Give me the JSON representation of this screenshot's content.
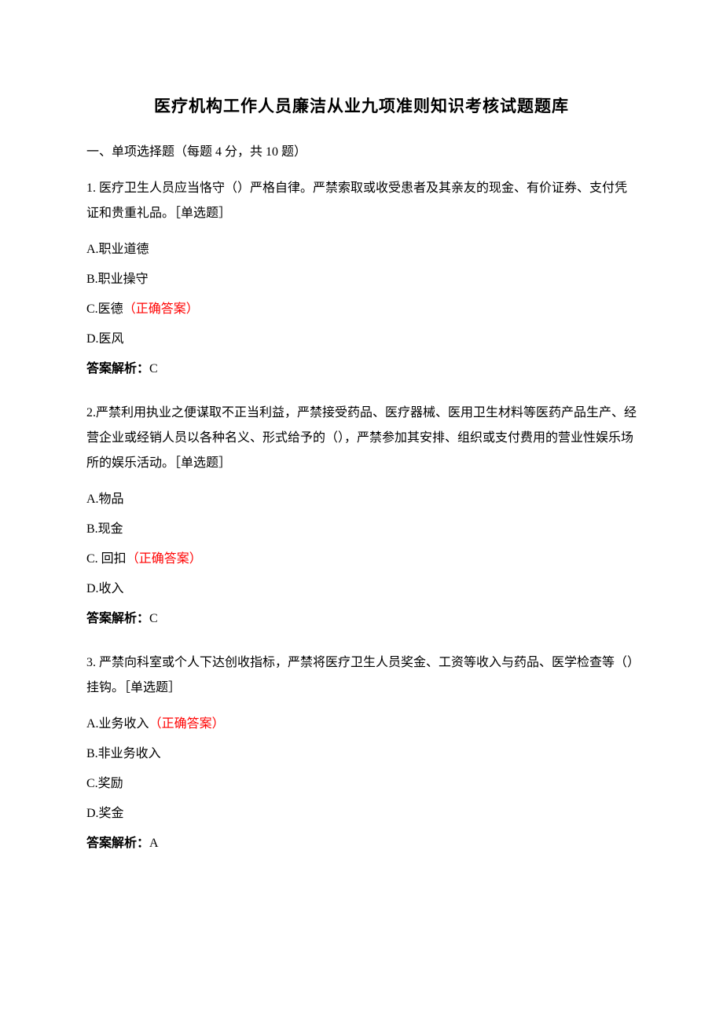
{
  "title": "医疗机构工作人员廉洁从业九项准则知识考核试题题库",
  "section_header": "一、单项选择题（每题 4 分，共 10 题）",
  "correct_marker": "（正确答案）",
  "analysis_label": "答案解析：",
  "q1": {
    "stem": "1. 医疗卫生人员应当恪守（）严格自律。严禁索取或收受患者及其亲友的现金、有价证券、支付凭证和贵重礼品。［单选题］",
    "optA": "A.职业道德",
    "optB": "B.职业操守",
    "optC": "C.医德",
    "optD": "D.医风",
    "analysis": "C"
  },
  "q2": {
    "stem": "2.严禁利用执业之便谋取不正当利益，严禁接受药品、医疗器械、医用卫生材料等医药产品生产、经营企业或经销人员以各种名义、形式给予的（），严禁参加其安排、组织或支付费用的营业性娱乐场所的娱乐活动。［单选题］",
    "optA": "A.物品",
    "optB": "B.现金",
    "optC": "C. 回扣",
    "optD": "D.收入",
    "analysis": "C"
  },
  "q3": {
    "stem": "3. 严禁向科室或个人下达创收指标，严禁将医疗卫生人员奖金、工资等收入与药品、医学检查等（）挂钩。［单选题］",
    "optA": "A.业务收入",
    "optB": "B.非业务收入",
    "optC": "C.奖励",
    "optD": "D.奖金",
    "analysis": "A"
  }
}
